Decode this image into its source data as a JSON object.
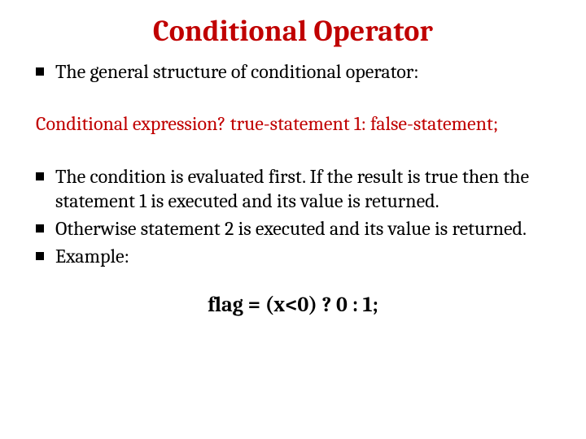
{
  "title": "Conditional Operator",
  "bullets_top": [
    "The general structure of conditional operator:"
  ],
  "expression": "Conditional expression? true-statement 1: false-statement;",
  "bullets_bottom": [
    "The condition is evaluated first. If the result is true then the statement 1 is executed and its value is returned.",
    "Otherwise statement 2 is executed and its value is returned.",
    "Example:"
  ],
  "example": "flag = (x<0) ? 0 : 1;"
}
